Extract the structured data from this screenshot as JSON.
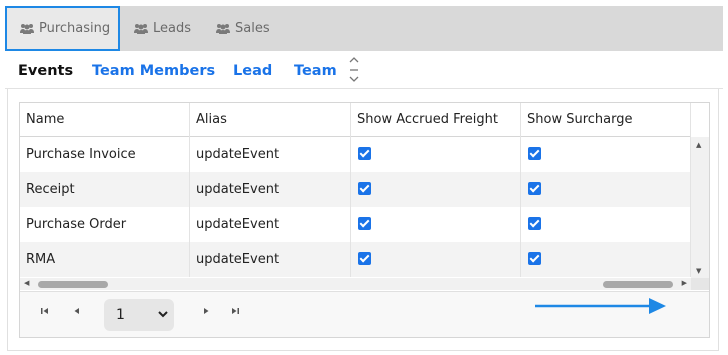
{
  "top_tabs": [
    {
      "label": "Purchasing",
      "icon": "users-icon",
      "active": true
    },
    {
      "label": "Leads",
      "icon": "users-icon"
    },
    {
      "label": "Sales",
      "icon": "users-icon"
    }
  ],
  "sub_tabs": [
    {
      "label": "Events",
      "active": true
    },
    {
      "label": "Team Members"
    },
    {
      "label": "Lead"
    },
    {
      "label": "Team"
    }
  ],
  "grid": {
    "columns": [
      "Name",
      "Alias",
      "Show Accrued Freight",
      "Show Surcharge"
    ],
    "rows": [
      {
        "name": "Purchase Invoice",
        "alias": "updateEvent",
        "accrued_freight": true,
        "surcharge": true
      },
      {
        "name": "Receipt",
        "alias": "updateEvent",
        "accrued_freight": true,
        "surcharge": true
      },
      {
        "name": "Purchase Order",
        "alias": "updateEvent",
        "accrued_freight": true,
        "surcharge": true
      },
      {
        "name": "RMA",
        "alias": "updateEvent",
        "accrued_freight": true,
        "surcharge": true
      }
    ]
  },
  "pager": {
    "page": "1"
  },
  "colors": {
    "accent": "#1a73e8",
    "active_tab_border": "#1e88e5",
    "annotation_arrow": "#1e88e5"
  }
}
